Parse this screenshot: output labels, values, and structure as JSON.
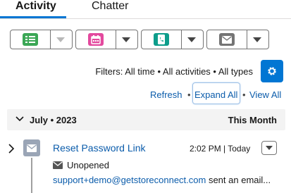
{
  "tabs": [
    {
      "label": "Activity",
      "active": true
    },
    {
      "label": "Chatter",
      "active": false
    }
  ],
  "colors": {
    "accent": "#0176d3",
    "task": "#3ba755",
    "event": "#e3499e",
    "call": "#0d9d8b",
    "email": "#747474",
    "timeline_email": "#9aa5b6"
  },
  "action_buttons": [
    {
      "icon": "task-icon",
      "dropdown_enabled": false
    },
    {
      "icon": "event-calendar-icon",
      "dropdown_enabled": true
    },
    {
      "icon": "log-call-icon",
      "dropdown_enabled": true
    },
    {
      "icon": "email-icon",
      "dropdown_enabled": true
    }
  ],
  "filters": {
    "text": "Filters: All time • All activities • All types",
    "settings_icon": "gear-icon"
  },
  "links": {
    "refresh": "Refresh",
    "expand_all": "Expand All",
    "view_all": "View All",
    "separator": "•"
  },
  "month_group": {
    "label": "July • 2023",
    "right_label": "This Month"
  },
  "timeline_item": {
    "title": "Reset Password Link",
    "time": "2:02 PM | Today",
    "status": "Unopened",
    "from": "support+demo@getstoreconnect.com",
    "summary": " sent an email..."
  }
}
